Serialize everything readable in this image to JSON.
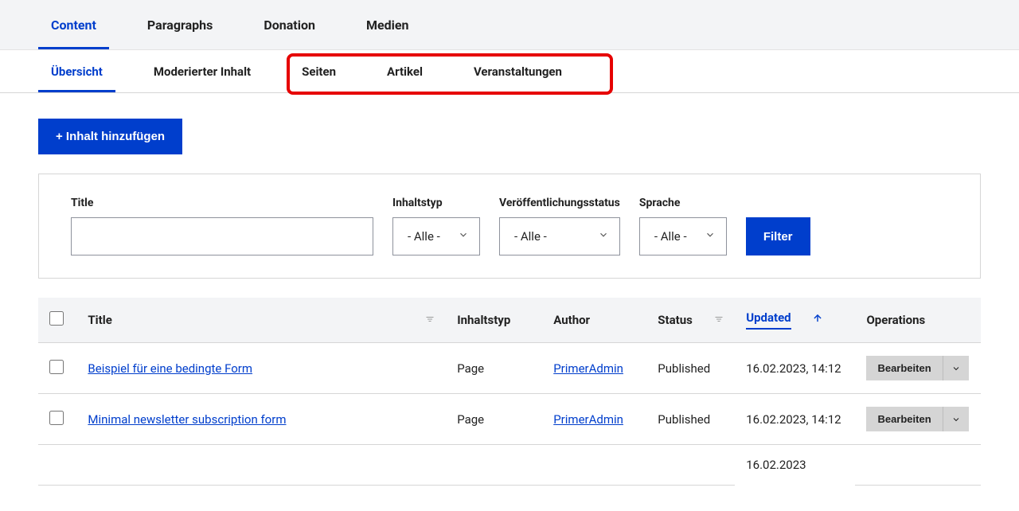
{
  "primaryTabs": [
    "Content",
    "Paragraphs",
    "Donation",
    "Medien"
  ],
  "primaryActive": 0,
  "secondaryTabs": [
    "Übersicht",
    "Moderierter Inhalt",
    "Seiten",
    "Artikel",
    "Veranstaltungen"
  ],
  "secondaryActive": 0,
  "actions": {
    "addContent": "+ Inhalt hinzufügen"
  },
  "filters": {
    "titleLabel": "Title",
    "titleValue": "",
    "typeLabel": "Inhaltstyp",
    "typeValue": "- Alle -",
    "statusLabel": "Veröffentlichungsstatus",
    "statusValue": "- Alle -",
    "langLabel": "Sprache",
    "langValue": "- Alle -",
    "submit": "Filter"
  },
  "table": {
    "headers": {
      "title": "Title",
      "type": "Inhaltstyp",
      "author": "Author",
      "status": "Status",
      "updated": "Updated",
      "ops": "Operations"
    },
    "rows": [
      {
        "title": "Beispiel für eine bedingte Form",
        "type": "Page",
        "author": "PrimerAdmin",
        "status": "Published",
        "updated": "16.02.2023, 14:12",
        "op": "Bearbeiten"
      },
      {
        "title": "Minimal newsletter subscription form",
        "type": "Page",
        "author": "PrimerAdmin",
        "status": "Published",
        "updated": "16.02.2023, 14:12",
        "op": "Bearbeiten"
      }
    ],
    "partialDate": "16.02.2023"
  }
}
